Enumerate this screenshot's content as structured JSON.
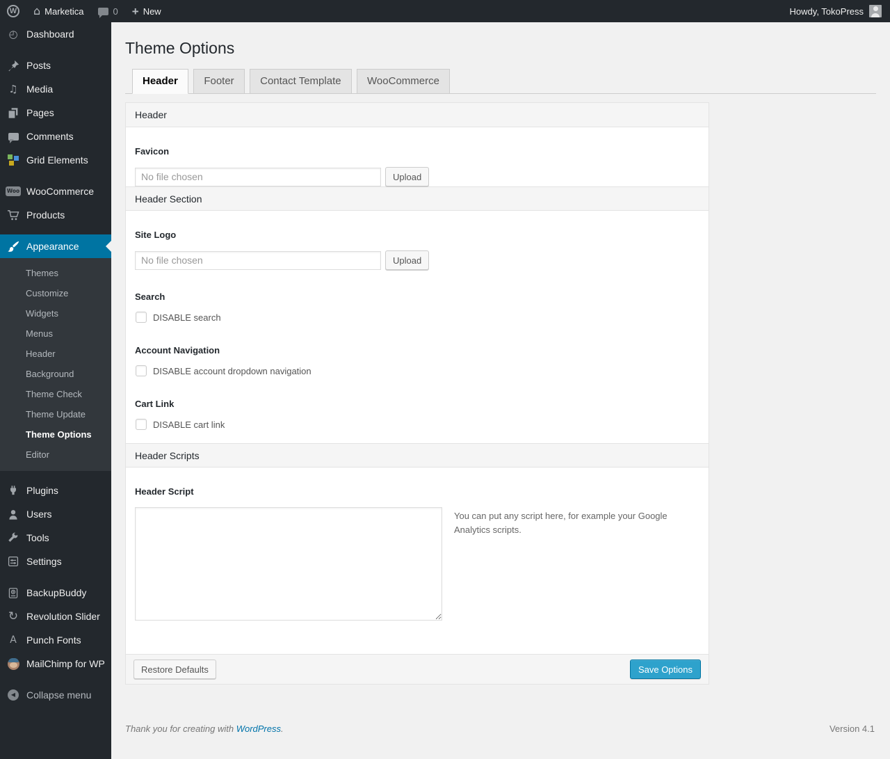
{
  "admin_bar": {
    "wp_logo_glyph": "W",
    "site_name": "Marketica",
    "comment_count": "0",
    "new_label": "New",
    "howdy_text": "Howdy, TokoPress"
  },
  "icons": {
    "home": "⌂",
    "dashboard": "◴",
    "media": "♫",
    "revolution_slider": "↻",
    "punch_fonts": "A",
    "collapse_arrow": "◀",
    "plus": "+",
    "woo_badge": "Woo"
  },
  "sidebar": {
    "items": [
      "Dashboard",
      "Posts",
      "Media",
      "Pages",
      "Comments",
      "Grid Elements",
      "WooCommerce",
      "Products",
      "Appearance",
      "Plugins",
      "Users",
      "Tools",
      "Settings",
      "BackupBuddy",
      "Revolution Slider",
      "Punch Fonts",
      "MailChimp for WP"
    ],
    "appearance_submenu": [
      "Themes",
      "Customize",
      "Widgets",
      "Menus",
      "Header",
      "Background",
      "Theme Check",
      "Theme Update",
      "Theme Options",
      "Editor"
    ],
    "current_item": "Appearance",
    "current_submenu_item": "Theme Options",
    "collapse_label": "Collapse menu"
  },
  "page": {
    "title": "Theme Options",
    "tabs": [
      "Header",
      "Footer",
      "Contact Template",
      "WooCommerce"
    ],
    "active_tab": "Header"
  },
  "panel": {
    "band_header": "Header",
    "band_header_section": "Header Section",
    "band_header_scripts": "Header Scripts",
    "favicon_label": "Favicon",
    "favicon_placeholder": "No file chosen",
    "favicon_upload": "Upload",
    "site_logo_label": "Site Logo",
    "site_logo_placeholder": "No file chosen",
    "site_logo_upload": "Upload",
    "search_label": "Search",
    "search_checkbox": "DISABLE search",
    "account_nav_label": "Account Navigation",
    "account_nav_checkbox": "DISABLE account dropdown navigation",
    "cart_link_label": "Cart Link",
    "cart_link_checkbox": "DISABLE cart link",
    "header_script_label": "Header Script",
    "header_script_value": "",
    "header_script_help": "You can put any script here, for example your Google Analytics scripts.",
    "restore_button": "Restore Defaults",
    "save_button": "Save Options"
  },
  "footer": {
    "thanks_prefix": "Thank you for creating with ",
    "wordpress_link": "WordPress",
    "thanks_suffix": ".",
    "version": "Version 4.1"
  },
  "colors": {
    "accent_blue": "#0074a2",
    "primary_button_blue": "#2ea2cc",
    "admin_bar_bg": "#23282d",
    "submenu_bg": "#32373c",
    "link_blue": "#0073aa",
    "content_bg": "#f1f1f1"
  }
}
